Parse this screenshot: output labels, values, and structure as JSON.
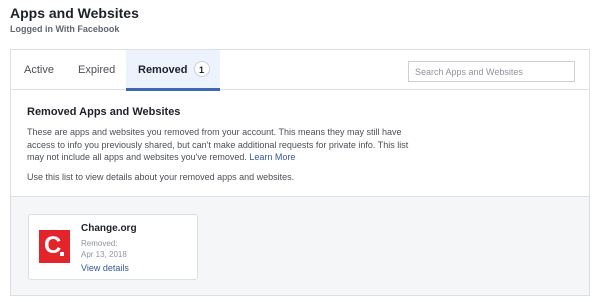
{
  "header": {
    "title": "Apps and Websites",
    "subtitle": "Logged in With Facebook"
  },
  "tabs": [
    {
      "label": "Active"
    },
    {
      "label": "Expired"
    },
    {
      "label": "Removed",
      "count": "1"
    }
  ],
  "active_tab": "Removed",
  "search": {
    "placeholder": "Search Apps and Websites"
  },
  "section": {
    "title": "Removed Apps and Websites",
    "description": "These are apps and websites you removed from your account. This means they may still have access to info you previously shared, but can't make additional requests for private info. This list may not include all apps and websites you've removed.",
    "learn_more": "Learn More",
    "note": "Use this list to view details about your removed apps and websites."
  },
  "apps": [
    {
      "name": "Change.org",
      "logo_text": "C",
      "logo_color": "#e3242b",
      "removed_label": "Removed:",
      "removed_date": "Apr 13, 2018",
      "action": "View details"
    }
  ],
  "colors": {
    "link": "#365899",
    "accent": "#4267b2",
    "active_tab_bg": "#edf3fd"
  }
}
